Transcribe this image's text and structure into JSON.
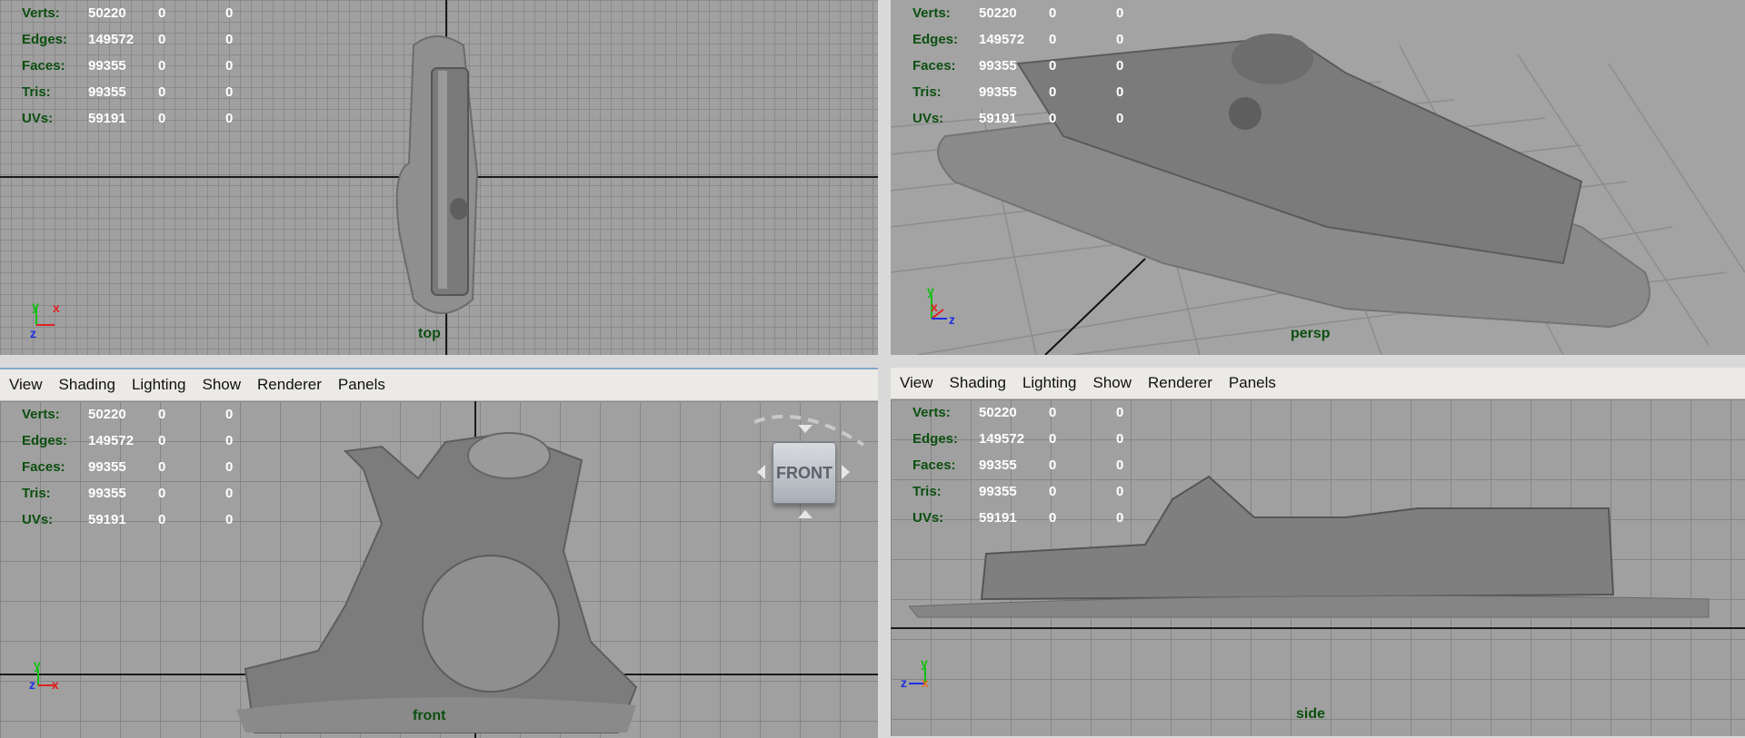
{
  "stats": {
    "rows": [
      {
        "label": "Verts:",
        "v1": "50220",
        "v2": "0",
        "v3": "0"
      },
      {
        "label": "Edges:",
        "v1": "149572",
        "v2": "0",
        "v3": "0"
      },
      {
        "label": "Faces:",
        "v1": "99355",
        "v2": "0",
        "v3": "0"
      },
      {
        "label": "Tris:",
        "v1": "99355",
        "v2": "0",
        "v3": "0"
      },
      {
        "label": "UVs:",
        "v1": "59191",
        "v2": "0",
        "v3": "0"
      }
    ]
  },
  "menu": {
    "items": [
      "View",
      "Shading",
      "Lighting",
      "Show",
      "Renderer",
      "Panels"
    ]
  },
  "viewports": {
    "top": {
      "name": "top"
    },
    "persp": {
      "name": "persp"
    },
    "front": {
      "name": "front",
      "cube_label": "FRONT"
    },
    "side": {
      "name": "side"
    }
  },
  "axes": {
    "x": "x",
    "y": "y",
    "z": "z"
  },
  "colors": {
    "axis_x": "#e02020",
    "axis_y": "#10c010",
    "axis_z": "#2030e0",
    "hud_label": "#0c4f10",
    "menubar_bg": "#eceae6"
  }
}
